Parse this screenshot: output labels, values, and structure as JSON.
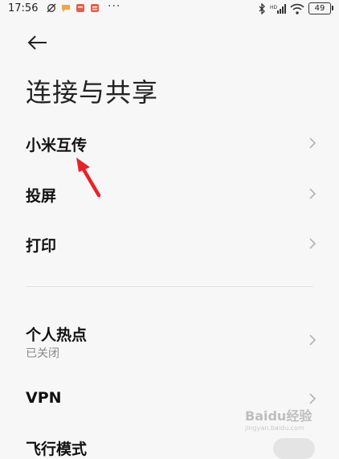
{
  "status_bar": {
    "time": "17:56",
    "battery": "49",
    "dots": "···"
  },
  "header": {
    "title": "连接与共享"
  },
  "settings": {
    "items": [
      {
        "label": "小米互传"
      },
      {
        "label": "投屏"
      },
      {
        "label": "打印"
      },
      {
        "label": "个人热点",
        "sub": "已关闭"
      },
      {
        "label": "VPN"
      },
      {
        "label": "飞行模式",
        "toggle_on": false
      }
    ]
  },
  "watermark": {
    "text": "Baidu经验",
    "sub": "jingyan.baidu.com"
  },
  "colors": {
    "background": "#f7f7f7",
    "annotation_arrow": "#e8232a",
    "notif_orange": "#f4a442",
    "notif_red": "#e85d4a"
  }
}
